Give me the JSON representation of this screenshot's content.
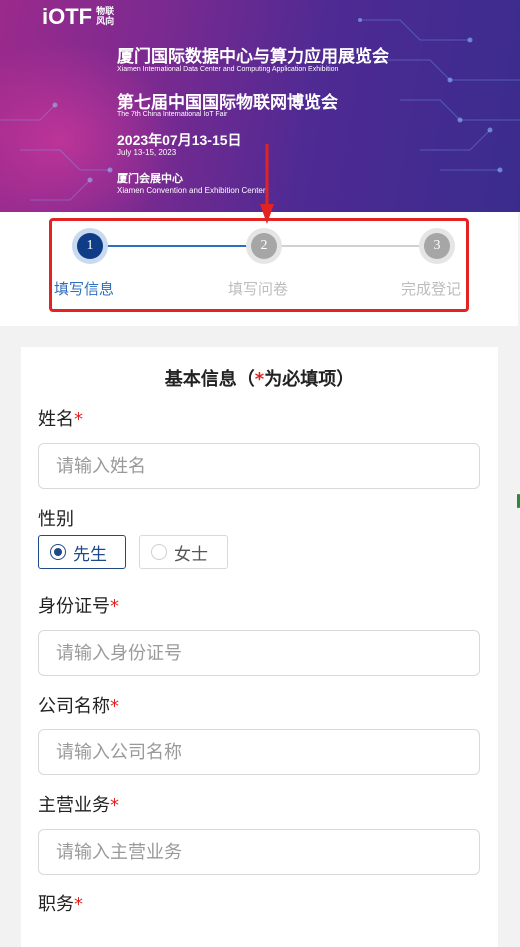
{
  "banner": {
    "logo_main": "iOTF",
    "logo_sub": "物联风向",
    "title_zh_1": "厦门国际数据中心与算力应用展览会",
    "title_en_1": "Xiamen International Data Center and Computing Application Exhibition",
    "title_zh_2": "第七届中国国际物联网博览会",
    "title_en_2": "The 7th China International IoT Fair",
    "date_zh": "2023年07月13-15日",
    "date_en": "July 13-15, 2023",
    "venue_zh": "厦门会展中心",
    "venue_en": "Xiamen Convention and Exhibition Center"
  },
  "steps": [
    {
      "number": "1",
      "label": "填写信息",
      "status": "active"
    },
    {
      "number": "2",
      "label": "填写问卷",
      "status": "pending"
    },
    {
      "number": "3",
      "label": "完成登记",
      "status": "pending"
    }
  ],
  "form": {
    "title_prefix": "基本信息（",
    "title_star": "*",
    "title_suffix": "为必填项）",
    "required_mark": "*",
    "name": {
      "label": "姓名",
      "placeholder": "请输入姓名"
    },
    "gender": {
      "label": "性别",
      "options": [
        "先生",
        "女士"
      ],
      "selected": "先生"
    },
    "id_number": {
      "label": "身份证号",
      "placeholder": "请输入身份证号"
    },
    "company": {
      "label": "公司名称",
      "placeholder": "请输入公司名称"
    },
    "business": {
      "label": "主营业务",
      "placeholder": "请输入主营业务"
    },
    "position": {
      "label": "职务"
    }
  },
  "colors": {
    "accent": "#0f3c87",
    "step_active": "#2d6fbf",
    "highlight_box": "#e32222",
    "required": "#e32222"
  }
}
